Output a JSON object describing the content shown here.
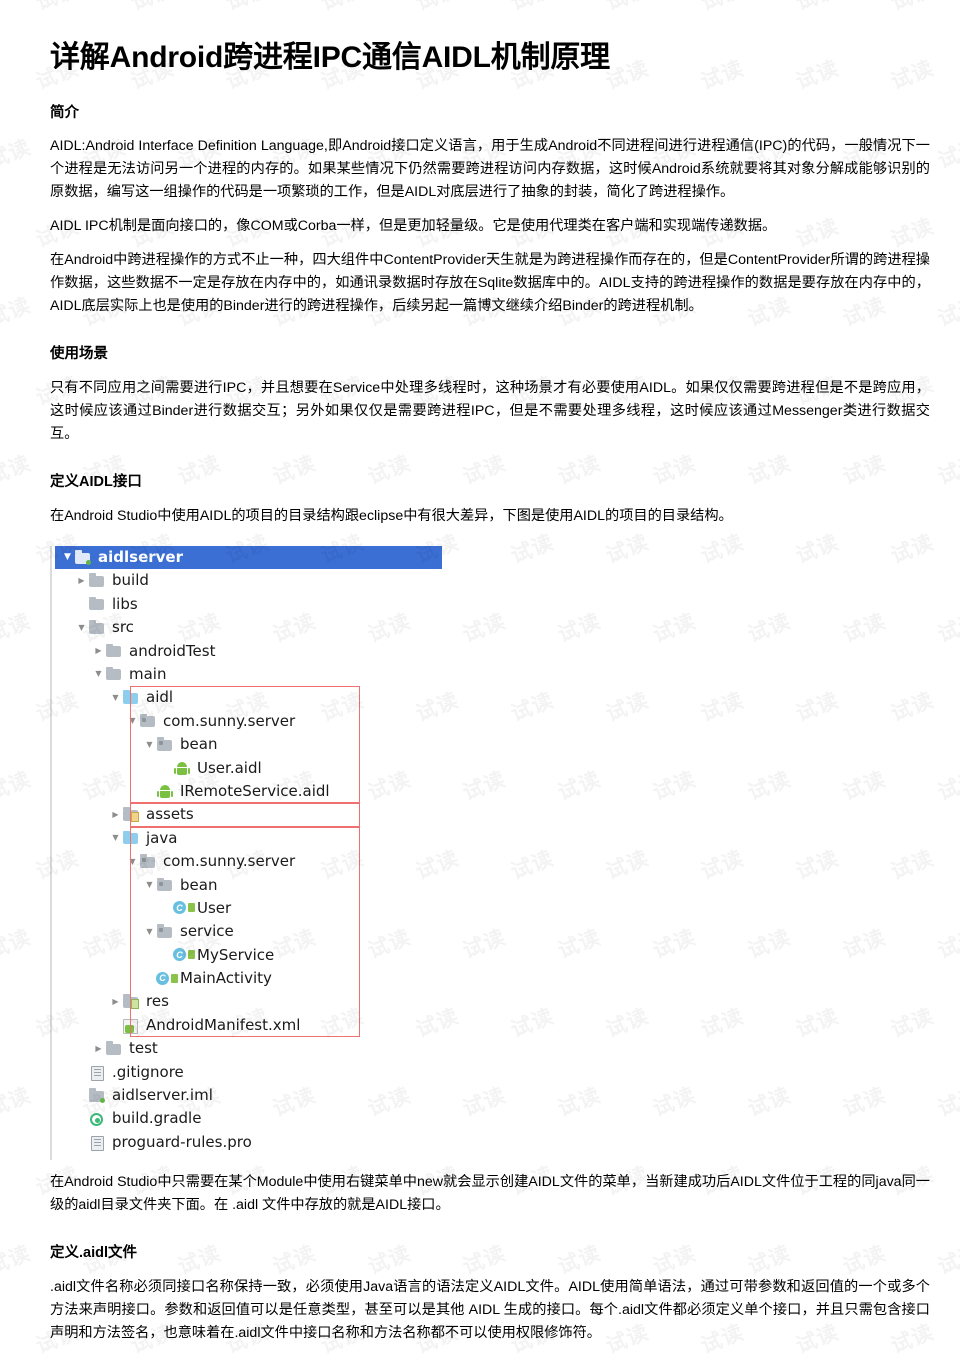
{
  "document": {
    "title": "详解Android跨进程IPC通信AIDL机制原理",
    "watermark_text": "试读"
  },
  "sections": [
    {
      "heading": "简介",
      "paragraphs": [
        "AIDL:Android Interface Definition Language,即Android接口定义语言，用于生成Android不同进程间进行进程通信(IPC)的代码，一般情况下一个进程是无法访问另一个进程的内存的。如果某些情况下仍然需要跨进程访问内存数据，这时候Android系统就要将其对象分解成能够识别的原数据，编写这一组操作的代码是一项繁琐的工作，但是AIDL对底层进行了抽象的封装，简化了跨进程操作。",
        "AIDL IPC机制是面向接口的，像COM或Corba一样，但是更加轻量级。它是使用代理类在客户端和实现端传递数据。",
        "在Android中跨进程操作的方式不止一种，四大组件中ContentProvider天生就是为跨进程操作而存在的，但是ContentProvider所谓的跨进程操作数据，这些数据不一定是存放在内存中的，如通讯录数据时存放在Sqlite数据库中的。AIDL支持的跨进程操作的数据是要存放在内存中的，AIDL底层实际上也是使用的Binder进行的跨进程操作，后续另起一篇博文继续介绍Binder的跨进程机制。"
      ]
    },
    {
      "heading": "使用场景",
      "paragraphs": [
        "只有不同应用之间需要进行IPC，并且想要在Service中处理多线程时，这种场景才有必要使用AIDL。如果仅仅需要跨进程但是不是跨应用，这时候应该通过Binder进行数据交互；另外如果仅仅是需要跨进程IPC，但是不需要处理多线程，这时候应该通过Messenger类进行数据交互。"
      ]
    },
    {
      "heading": "定义AIDL接口",
      "paragraphs": [
        "在Android Studio中使用AIDL的项目的目录结构跟eclipse中有很大差异，下图是使用AIDL的项目的目录结构。"
      ]
    }
  ],
  "figure": {
    "caption": "",
    "highlight_color": "#f07070",
    "selection_color": "#3b6fd4",
    "tree": [
      {
        "label": "aidlserver",
        "indent": 0,
        "arrow": "down",
        "icon": "module-folder-icon",
        "selected": true
      },
      {
        "label": "build",
        "indent": 1,
        "arrow": "right",
        "icon": "folder-icon",
        "selected": false
      },
      {
        "label": "libs",
        "indent": 1,
        "arrow": "none",
        "icon": "folder-icon",
        "selected": false
      },
      {
        "label": "src",
        "indent": 1,
        "arrow": "down",
        "icon": "folder-icon",
        "selected": false
      },
      {
        "label": "androidTest",
        "indent": 2,
        "arrow": "right",
        "icon": "folder-icon",
        "selected": false
      },
      {
        "label": "main",
        "indent": 2,
        "arrow": "down",
        "icon": "folder-icon",
        "selected": false
      },
      {
        "label": "aidl",
        "indent": 3,
        "arrow": "down",
        "icon": "source-folder-icon",
        "selected": false
      },
      {
        "label": "com.sunny.server",
        "indent": 4,
        "arrow": "down",
        "icon": "package-icon",
        "selected": false
      },
      {
        "label": "bean",
        "indent": 5,
        "arrow": "down",
        "icon": "package-icon",
        "selected": false
      },
      {
        "label": "User.aidl",
        "indent": 6,
        "arrow": "none",
        "icon": "android-file-icon",
        "selected": false
      },
      {
        "label": "IRemoteService.aidl",
        "indent": 5,
        "arrow": "none",
        "icon": "android-file-icon",
        "selected": false
      },
      {
        "label": "assets",
        "indent": 3,
        "arrow": "right",
        "icon": "assets-folder-icon",
        "selected": false
      },
      {
        "label": "java",
        "indent": 3,
        "arrow": "down",
        "icon": "source-folder-icon",
        "selected": false
      },
      {
        "label": "com.sunny.server",
        "indent": 4,
        "arrow": "down",
        "icon": "package-icon",
        "selected": false
      },
      {
        "label": "bean",
        "indent": 5,
        "arrow": "down",
        "icon": "package-icon",
        "selected": false
      },
      {
        "label": "User",
        "indent": 6,
        "arrow": "none",
        "icon": "java-class-icon",
        "selected": false
      },
      {
        "label": "service",
        "indent": 5,
        "arrow": "down",
        "icon": "package-icon",
        "selected": false
      },
      {
        "label": "MyService",
        "indent": 6,
        "arrow": "none",
        "icon": "java-class-icon",
        "selected": false
      },
      {
        "label": "MainActivity",
        "indent": 5,
        "arrow": "none",
        "icon": "java-class-icon",
        "selected": false
      },
      {
        "label": "res",
        "indent": 3,
        "arrow": "right",
        "icon": "res-folder-icon",
        "selected": false
      },
      {
        "label": "AndroidManifest.xml",
        "indent": 3,
        "arrow": "none",
        "icon": "manifest-icon",
        "selected": false
      },
      {
        "label": "test",
        "indent": 2,
        "arrow": "right",
        "icon": "folder-icon",
        "selected": false
      },
      {
        "label": ".gitignore",
        "indent": 1,
        "arrow": "none",
        "icon": "text-file-icon",
        "selected": false
      },
      {
        "label": "aidlserver.iml",
        "indent": 1,
        "arrow": "none",
        "icon": "module-folder-icon",
        "selected": false
      },
      {
        "label": "build.gradle",
        "indent": 1,
        "arrow": "none",
        "icon": "gradle-icon",
        "selected": false
      },
      {
        "label": "proguard-rules.pro",
        "indent": 1,
        "arrow": "none",
        "icon": "text-file-icon",
        "selected": false
      }
    ]
  },
  "sections_after_figure": [
    {
      "heading": "",
      "paragraphs": [
        "在Android Studio中只需要在某个Module中使用右键菜单中new就会显示创建AIDL文件的菜单，当新建成功后AIDL文件位于工程的同java同一级的aidl目录文件夹下面。在 .aidl 文件中存放的就是AIDL接口。"
      ]
    },
    {
      "heading": "定义.aidl文件",
      "paragraphs": [
        ".aidl文件名称必须同接口名称保持一致，必须使用Java语言的语法定义AIDL文件。AIDL使用简单语法，通过可带参数和返回值的一个或多个方法来声明接口。参数和返回值可以是任意类型，甚至可以是其他 AIDL 生成的接口。每个.aidl文件都必须定义单个接口，并且只需包含接口声明和方法签名，也意味着在.aidl文件中接口名称和方法名称都不可以使用权限修饰符。"
      ]
    }
  ]
}
